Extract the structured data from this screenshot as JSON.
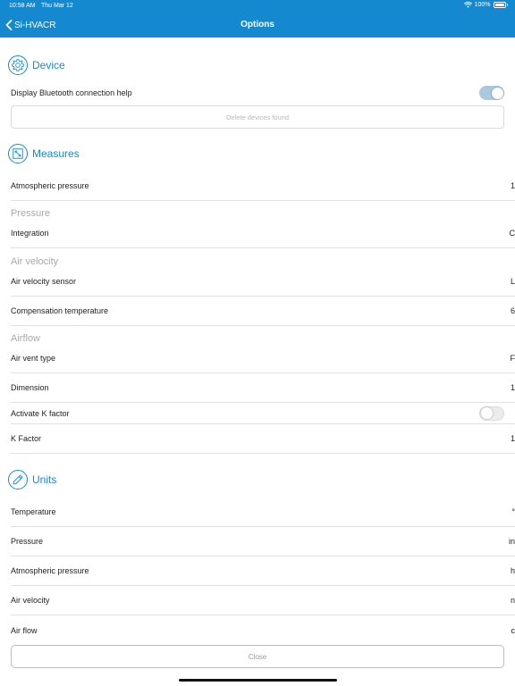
{
  "status_bar": {
    "time": "10:58 AM",
    "day": "Thu Mar 12",
    "battery": "100%"
  },
  "nav": {
    "back_label": "Si-HVACR",
    "title": "Options"
  },
  "device": {
    "title": "Device",
    "bt_help_label": "Display Bluetooth connection help",
    "bt_help_enabled": true,
    "delete_label": "Delete devices found"
  },
  "measures": {
    "title": "Measures",
    "atm_pressure": {
      "label": "Atmospheric pressure",
      "value": "1"
    },
    "pressure_header": "Pressure",
    "integration": {
      "label": "Integration",
      "value": "C"
    },
    "air_velocity_header": "Air velocity",
    "air_velocity_sensor": {
      "label": "Air velocity sensor",
      "value": "L"
    },
    "compensation_temp": {
      "label": "Compensation temperature",
      "value": "6"
    },
    "airflow_header": "Airflow",
    "air_vent_type": {
      "label": "Air vent type",
      "value": "F"
    },
    "dimension": {
      "label": "Dimension",
      "value": "1"
    },
    "activate_k": {
      "label": "Activate K factor",
      "enabled": false
    },
    "k_factor": {
      "label": "K Factor",
      "value": "1"
    }
  },
  "units": {
    "title": "Units",
    "temperature": {
      "label": "Temperature",
      "value": "°"
    },
    "pressure": {
      "label": "Pressure",
      "value": "in"
    },
    "atm_pressure": {
      "label": "Atmospheric pressure",
      "value": "h"
    },
    "air_velocity": {
      "label": "Air velocity",
      "value": "n"
    },
    "air_flow": {
      "label": "Air flow",
      "value": "c"
    }
  },
  "close_label": "Close",
  "colors": {
    "accent": "#1589cf",
    "toggle_on": "#a9c9dd",
    "subheader": "#a8a8a8"
  }
}
